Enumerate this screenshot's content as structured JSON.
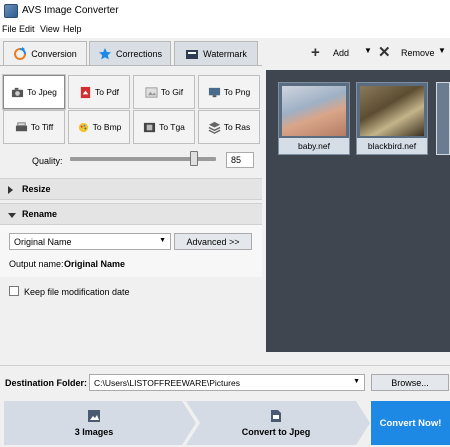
{
  "window": {
    "title": "AVS Image Converter"
  },
  "menu": {
    "items": [
      "File",
      "Edit",
      "View",
      "Help"
    ]
  },
  "tabs": [
    {
      "label": "Conversion"
    },
    {
      "label": "Corrections"
    },
    {
      "label": "Watermark"
    }
  ],
  "toolbar": {
    "add_label": "Add",
    "remove_label": "Remove"
  },
  "formats": [
    {
      "label": "To Jpeg"
    },
    {
      "label": "To Pdf"
    },
    {
      "label": "To Gif"
    },
    {
      "label": "To Png"
    },
    {
      "label": "To Tiff"
    },
    {
      "label": "To Bmp"
    },
    {
      "label": "To Tga"
    },
    {
      "label": "To Ras"
    }
  ],
  "selected_format": "To Jpeg",
  "quality": {
    "label": "Quality:",
    "value": "85",
    "fraction": 0.85
  },
  "sections": {
    "resize": "Resize",
    "rename": "Rename"
  },
  "rename": {
    "select_value": "Original Name",
    "advanced_button": "Advanced >>",
    "output_label": "Output name:",
    "output_value": "Original Name"
  },
  "keep_date": {
    "label": "Keep file modification date",
    "checked": false
  },
  "thumbnails": [
    {
      "caption": "baby.nef"
    },
    {
      "caption": "blackbird.nef"
    }
  ],
  "destination": {
    "label": "Destination Folder:",
    "path": "C:\\Users\\LISTOFFREEWARE\\Pictures",
    "browse": "Browse..."
  },
  "steps": {
    "images": "3 Images",
    "convert_to": "Convert to Jpeg",
    "convert_now": "Convert Now!"
  },
  "colors": {
    "accent": "#1e88e5",
    "thumb_bg": "#404650",
    "pdf_red": "#d32f2f"
  }
}
